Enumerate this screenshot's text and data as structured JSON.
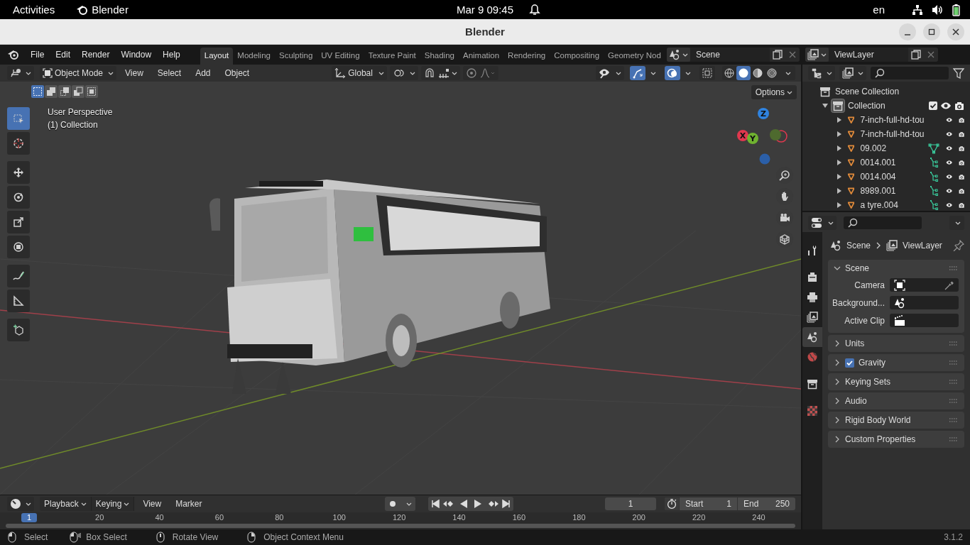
{
  "system_bar": {
    "activities": "Activities",
    "app": "Blender",
    "clock": "Mar 9  09:45",
    "language": "en"
  },
  "window": {
    "title": "Blender"
  },
  "menu": [
    "File",
    "Edit",
    "Render",
    "Window",
    "Help"
  ],
  "workspaces": [
    {
      "label": "Layout",
      "selected": true
    },
    {
      "label": "Modeling",
      "selected": false
    },
    {
      "label": "Sculpting",
      "selected": false
    },
    {
      "label": "UV Editing",
      "selected": false
    },
    {
      "label": "Texture Paint",
      "selected": false
    },
    {
      "label": "Shading",
      "selected": false
    },
    {
      "label": "Animation",
      "selected": false
    },
    {
      "label": "Rendering",
      "selected": false
    },
    {
      "label": "Compositing",
      "selected": false
    },
    {
      "label": "Geometry Nod",
      "selected": false
    }
  ],
  "scene": {
    "value": "Scene"
  },
  "view_layer": {
    "value": "ViewLayer"
  },
  "viewport": {
    "mode": "Object Mode",
    "menus": [
      "View",
      "Select",
      "Add",
      "Object"
    ],
    "orientation": "Global",
    "select_modes": [
      {
        "kind": "set",
        "selected": true
      },
      {
        "kind": "extend",
        "selected": false
      },
      {
        "kind": "subtract",
        "selected": false
      },
      {
        "kind": "invert",
        "selected": false
      },
      {
        "kind": "intersect",
        "selected": false
      }
    ],
    "toggles": [
      {
        "kind": "gizmo",
        "on": true
      },
      {
        "kind": "overlay",
        "on": true
      },
      {
        "kind": "xray",
        "on": false
      }
    ],
    "shading": [
      {
        "kind": "wireframe",
        "selected": false
      },
      {
        "kind": "solid",
        "selected": true
      },
      {
        "kind": "material",
        "selected": false
      },
      {
        "kind": "rendered",
        "selected": false
      }
    ],
    "options": "Options",
    "overlay_text": [
      "User Perspective",
      "(1) Collection"
    ],
    "tools": [
      {
        "kind": "select",
        "selected": true
      },
      {
        "kind": "cursor",
        "selected": false
      },
      {
        "kind": "move",
        "selected": false
      },
      {
        "kind": "rotate",
        "selected": false
      },
      {
        "kind": "scale",
        "selected": false
      },
      {
        "kind": "transform",
        "selected": false
      },
      {
        "kind": "annotate",
        "selected": false
      },
      {
        "kind": "measure",
        "selected": false
      },
      {
        "kind": "add_cube",
        "selected": false
      }
    ],
    "gizmo": [
      "Z",
      "X",
      "Y"
    ],
    "nav": [
      {
        "kind": "zoom"
      },
      {
        "kind": "pan"
      },
      {
        "kind": "camera"
      },
      {
        "kind": "ortho"
      }
    ]
  },
  "outliner": {
    "root": "Scene Collection",
    "collection": {
      "label": "Collection",
      "expanded": true,
      "checked": true,
      "children": [
        {
          "label": "7-inch-full-hd-tou",
          "kind": "plain"
        },
        {
          "label": "7-inch-full-hd-tou",
          "kind": "plain"
        },
        {
          "label": "09.002",
          "kind": "triangle"
        },
        {
          "label": "0014.001",
          "kind": "branch"
        },
        {
          "label": "0014.004",
          "kind": "branch"
        },
        {
          "label": "8989.001",
          "kind": "branch"
        },
        {
          "label": "a tyre.004",
          "kind": "branch"
        }
      ]
    }
  },
  "properties": {
    "tabs": [
      {
        "kind": "tool",
        "selected": false
      },
      {
        "kind": "render",
        "selected": false
      },
      {
        "kind": "output",
        "selected": false
      },
      {
        "kind": "view_layer",
        "selected": false
      },
      {
        "kind": "scene",
        "selected": true
      },
      {
        "kind": "world",
        "selected": false
      },
      {
        "kind": "collection",
        "selected": false
      },
      {
        "kind": "texture",
        "selected": false
      }
    ],
    "breadcrumb": [
      "Scene",
      "ViewLayer"
    ],
    "panels": [
      {
        "label": "Scene",
        "expanded": true,
        "fields": [
          {
            "label": "Camera",
            "kind": "camera"
          },
          {
            "label": "Background...",
            "kind": "scene"
          },
          {
            "label": "Active Clip",
            "kind": "clip"
          }
        ]
      },
      {
        "label": "Units",
        "expanded": false
      },
      {
        "label": "Gravity",
        "expanded": false,
        "checked": true
      },
      {
        "label": "Keying Sets",
        "expanded": false
      },
      {
        "label": "Audio",
        "expanded": false
      },
      {
        "label": "Rigid Body World",
        "expanded": false
      },
      {
        "label": "Custom Properties",
        "expanded": false
      }
    ]
  },
  "timeline": {
    "menus": [
      "Playback",
      "Keying"
    ],
    "plain_menus": [
      "View",
      "Marker"
    ],
    "current_frame": "1",
    "start": {
      "label": "Start",
      "value": "1"
    },
    "end": {
      "label": "End",
      "value": "250"
    },
    "playhead": "1",
    "ticks": [
      "20",
      "40",
      "60",
      "80",
      "100",
      "120",
      "140",
      "160",
      "180",
      "200",
      "220",
      "240"
    ]
  },
  "status_bar": {
    "hints": [
      {
        "kind": "lmb",
        "label": "Select"
      },
      {
        "kind": "drag",
        "label": "Box Select"
      },
      {
        "kind": "mmb",
        "label": "Rotate View"
      },
      {
        "kind": "rmb",
        "label": "Object Context Menu"
      }
    ],
    "version": "3.1.2"
  }
}
